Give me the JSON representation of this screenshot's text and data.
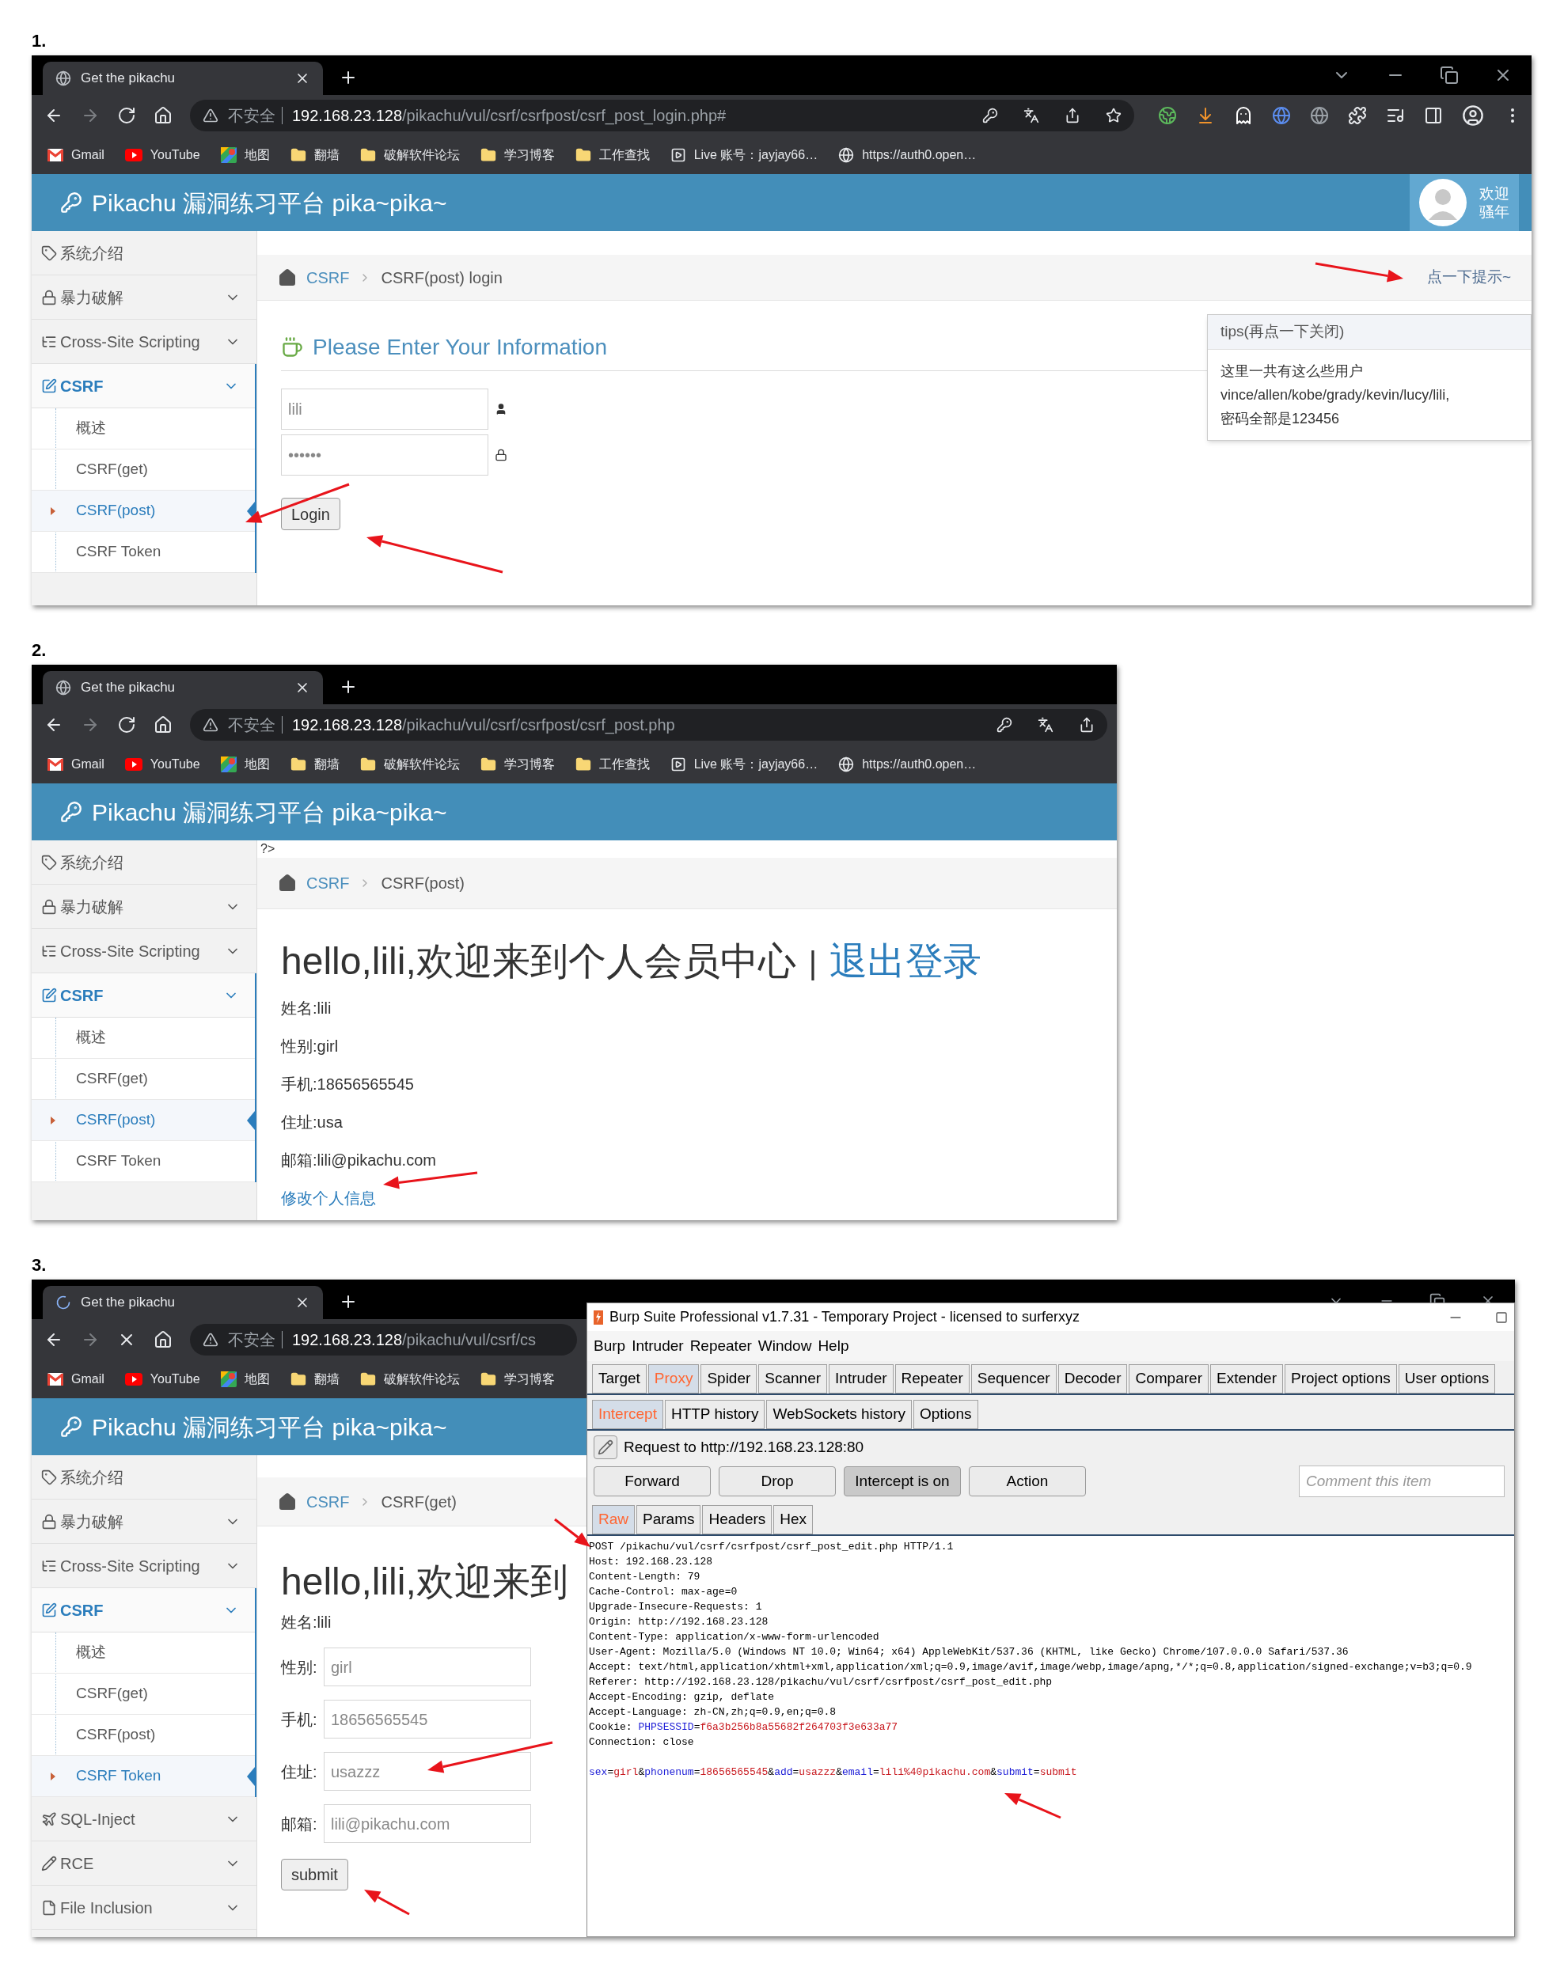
{
  "panels": [
    {
      "label": "1.",
      "browser": {
        "tab_title": "Get the pikachu",
        "loading": false,
        "window_controls": true,
        "secure_label": "不安全",
        "url_host": "192.168.23.128",
        "url_path": "/pikachu/vul/csrf/csrfpost/csrf_post_login.php#",
        "page_actions": true,
        "extensions": true,
        "bookmarks": [
          {
            "kind": "mail",
            "label": "Gmail"
          },
          {
            "kind": "video",
            "label": "YouTube"
          },
          {
            "kind": "map",
            "label": "地图"
          },
          {
            "kind": "folder",
            "label": "翻墙"
          },
          {
            "kind": "folder",
            "label": "破解软件论坛"
          },
          {
            "kind": "folder",
            "label": "学习博客"
          },
          {
            "kind": "folder",
            "label": "工作查找"
          },
          {
            "kind": "media",
            "label": "Live 账号：jayjay66…"
          },
          {
            "kind": "site",
            "label": "https://auth0.open…"
          }
        ]
      },
      "site": {
        "title": "Pikachu 漏洞练习平台 pika~pika~",
        "user": {
          "greeting": [
            "欢迎",
            "骚年"
          ]
        }
      },
      "sidebar": [
        {
          "kind": "link",
          "label": "系统介绍",
          "selected": false
        },
        {
          "kind": "group",
          "label": "暴力破解",
          "selected": false
        },
        {
          "kind": "group",
          "label": "Cross-Site Scripting",
          "selected": false
        },
        {
          "kind": "group",
          "label": "CSRF",
          "selected": true,
          "children": [
            {
              "label": "概述",
              "selected": false
            },
            {
              "label": "CSRF(get)",
              "selected": false
            },
            {
              "label": "CSRF(post)",
              "selected": true
            },
            {
              "label": "CSRF Token",
              "selected": false
            }
          ]
        }
      ],
      "page": {
        "kind": "login",
        "breadcrumb": [
          "CSRF",
          "CSRF(post) login"
        ],
        "hint": "点一下提示~",
        "tips": {
          "title": "tips(再点一下关闭)",
          "lines": [
            "这里一共有这么些用户",
            "vince/allen/kobe/grady/kevin/lucy/lili,",
            "密码全部是123456"
          ]
        },
        "heading": "Please Enter Your Information",
        "username": "lili",
        "password": "••••••",
        "button": "Login"
      }
    },
    {
      "label": "2.",
      "browser": {
        "tab_title": "Get the pikachu",
        "loading": false,
        "secure_label": "不安全",
        "url_host": "192.168.23.128",
        "url_path": "/pikachu/vul/csrf/csrfpost/csrf_post.php",
        "page_actions": true,
        "extensions": false,
        "bookmarks": [
          {
            "kind": "mail",
            "label": "Gmail"
          },
          {
            "kind": "video",
            "label": "YouTube"
          },
          {
            "kind": "map",
            "label": "地图"
          },
          {
            "kind": "folder",
            "label": "翻墙"
          },
          {
            "kind": "folder",
            "label": "破解软件论坛"
          },
          {
            "kind": "folder",
            "label": "学习博客"
          },
          {
            "kind": "folder",
            "label": "工作查找"
          },
          {
            "kind": "media",
            "label": "Live 账号：jayjay66…"
          },
          {
            "kind": "site",
            "label": "https://auth0.open…"
          }
        ]
      },
      "site": {
        "title": "Pikachu 漏洞练习平台 pika~pika~"
      },
      "sidebar": [
        {
          "kind": "link",
          "label": "系统介绍",
          "selected": false
        },
        {
          "kind": "group",
          "label": "暴力破解",
          "selected": false
        },
        {
          "kind": "group",
          "label": "Cross-Site Scripting",
          "selected": false
        },
        {
          "kind": "group",
          "label": "CSRF",
          "selected": true,
          "children": [
            {
              "label": "概述",
              "selected": false
            },
            {
              "label": "CSRF(get)",
              "selected": false
            },
            {
              "label": "CSRF(post)",
              "selected": true
            },
            {
              "label": "CSRF Token",
              "selected": false
            }
          ]
        }
      ],
      "page": {
        "kind": "profile",
        "code_leak": "?>",
        "breadcrumb": [
          "CSRF",
          "CSRF(post)"
        ],
        "heading": "hello,lili,欢迎来到个人会员中心",
        "separator": "|",
        "logout": "退出登录",
        "info": [
          "姓名:lili",
          "性别:girl",
          "手机:18656565545",
          "住址:usa",
          "邮箱:lili@pikachu.com"
        ],
        "edit_link": "修改个人信息"
      }
    },
    {
      "label": "3.",
      "browser": {
        "tab_title": "Get the pikachu",
        "loading": true,
        "window_controls": true,
        "secure_label": "不安全",
        "url_host": "192.168.23.128",
        "url_path": "/pikachu/vul/csrf/cs",
        "bookmarks": [
          {
            "kind": "mail",
            "label": "Gmail"
          },
          {
            "kind": "video",
            "label": "YouTube"
          },
          {
            "kind": "map",
            "label": "地图"
          },
          {
            "kind": "folder",
            "label": "翻墙"
          },
          {
            "kind": "folder",
            "label": "破解软件论坛"
          },
          {
            "kind": "folder",
            "label": "学习博客"
          }
        ]
      },
      "site": {
        "title": "Pikachu 漏洞练习平台 pika~pika~"
      },
      "sidebar": [
        {
          "kind": "link",
          "label": "系统介绍",
          "selected": false
        },
        {
          "kind": "group",
          "label": "暴力破解",
          "selected": false
        },
        {
          "kind": "group",
          "label": "Cross-Site Scripting",
          "selected": false
        },
        {
          "kind": "group",
          "label": "CSRF",
          "selected": true,
          "children": [
            {
              "label": "概述",
              "selected": false
            },
            {
              "label": "CSRF(get)",
              "selected": false
            },
            {
              "label": "CSRF(post)",
              "selected": false
            },
            {
              "label": "CSRF Token",
              "selected": true
            }
          ]
        },
        {
          "kind": "group",
          "label": "SQL-Inject",
          "selected": false
        },
        {
          "kind": "group",
          "label": "RCE",
          "selected": false
        },
        {
          "kind": "group",
          "label": "File Inclusion",
          "selected": false
        }
      ],
      "page": {
        "kind": "edit",
        "breadcrumb": [
          "CSRF",
          "CSRF(get)"
        ],
        "heading": "hello,lili,欢迎来到",
        "name_line": "姓名:lili",
        "fields": [
          {
            "label": "性别:",
            "value": "girl"
          },
          {
            "label": "手机:",
            "value": "18656565545"
          },
          {
            "label": "住址:",
            "value": "usazzz"
          },
          {
            "label": "邮箱:",
            "value": "lili@pikachu.com"
          }
        ],
        "button": "submit"
      },
      "burp": {
        "title": "Burp Suite Professional v1.7.31 - Temporary Project - licensed to surferxyz",
        "menu": [
          "Burp",
          "Intruder",
          "Repeater",
          "Window",
          "Help"
        ],
        "tabs": [
          {
            "label": "Target",
            "selected": false
          },
          {
            "label": "Proxy",
            "selected": true
          },
          {
            "label": "Spider",
            "selected": false
          },
          {
            "label": "Scanner",
            "selected": false
          },
          {
            "label": "Intruder",
            "selected": false
          },
          {
            "label": "Repeater",
            "selected": false
          },
          {
            "label": "Sequencer",
            "selected": false
          },
          {
            "label": "Decoder",
            "selected": false
          },
          {
            "label": "Comparer",
            "selected": false
          },
          {
            "label": "Extender",
            "selected": false
          },
          {
            "label": "Project options",
            "selected": false
          },
          {
            "label": "User options",
            "selected": false
          }
        ],
        "subtabs": [
          {
            "label": "Intercept",
            "selected": true
          },
          {
            "label": "HTTP history",
            "selected": false
          },
          {
            "label": "WebSockets history",
            "selected": false
          },
          {
            "label": "Options",
            "selected": false
          }
        ],
        "request_to": "Request to http://192.168.23.128:80",
        "actions": [
          {
            "label": "Forward",
            "pressed": false
          },
          {
            "label": "Drop",
            "pressed": false
          },
          {
            "label": "Intercept is on",
            "pressed": true
          },
          {
            "label": "Action",
            "pressed": false
          }
        ],
        "comment_placeholder": "Comment this item",
        "views": [
          {
            "label": "Raw",
            "selected": true
          },
          {
            "label": "Params",
            "selected": false
          },
          {
            "label": "Headers",
            "selected": false
          },
          {
            "label": "Hex",
            "selected": false
          }
        ],
        "request": [
          {
            "text": "POST /pikachu/vul/csrf/csrfpost/csrf_post_edit.php HTTP/1.1"
          },
          {
            "text": "Host: 192.168.23.128"
          },
          {
            "text": "Content-Length: 79"
          },
          {
            "text": "Cache-Control: max-age=0"
          },
          {
            "text": "Upgrade-Insecure-Requests: 1"
          },
          {
            "text": "Origin: http://192.168.23.128"
          },
          {
            "text": "Content-Type: application/x-www-form-urlencoded"
          },
          {
            "text": "User-Agent: Mozilla/5.0 (Windows NT 10.0; Win64; x64) AppleWebKit/537.36 (KHTML, like Gecko) Chrome/107.0.0.0 Safari/537.36"
          },
          {
            "text": "Accept: text/html,application/xhtml+xml,application/xml;q=0.9,image/avif,image/webp,image/apng,*/*;q=0.8,application/signed-exchange;v=b3;q=0.9"
          },
          {
            "text": "Referer: http://192.168.23.128/pikachu/vul/csrf/csrfpost/csrf_post_edit.php"
          },
          {
            "text": "Accept-Encoding: gzip, deflate"
          },
          {
            "text": "Accept-Language: zh-CN,zh;q=0.9,en;q=0.8"
          },
          {
            "parts": [
              {
                "kind": "plain",
                "text": "Cookie: "
              },
              {
                "kind": "name",
                "text": "PHPSESSID"
              },
              {
                "kind": "plain",
                "text": "="
              },
              {
                "kind": "value",
                "text": "f6a3b256b8a55682f264703f3e633a77"
              }
            ]
          },
          {
            "text": "Connection: close"
          }
        ],
        "body": [
          {
            "kind": "name",
            "text": "sex"
          },
          {
            "kind": "plain",
            "text": "="
          },
          {
            "kind": "value",
            "text": "girl"
          },
          {
            "kind": "plain",
            "text": "&"
          },
          {
            "kind": "name",
            "text": "phonenum"
          },
          {
            "kind": "plain",
            "text": "="
          },
          {
            "kind": "value",
            "text": "18656565545"
          },
          {
            "kind": "plain",
            "text": "&"
          },
          {
            "kind": "name",
            "text": "add"
          },
          {
            "kind": "plain",
            "text": "="
          },
          {
            "kind": "value",
            "text": "usazzz"
          },
          {
            "kind": "plain",
            "text": "&"
          },
          {
            "kind": "name",
            "text": "email"
          },
          {
            "kind": "plain",
            "text": "="
          },
          {
            "kind": "value",
            "text": "lili%40pikachu.com"
          },
          {
            "kind": "plain",
            "text": "&"
          },
          {
            "kind": "name",
            "text": "submit"
          },
          {
            "kind": "plain",
            "text": "="
          },
          {
            "kind": "value",
            "text": "submit"
          }
        ]
      }
    }
  ]
}
